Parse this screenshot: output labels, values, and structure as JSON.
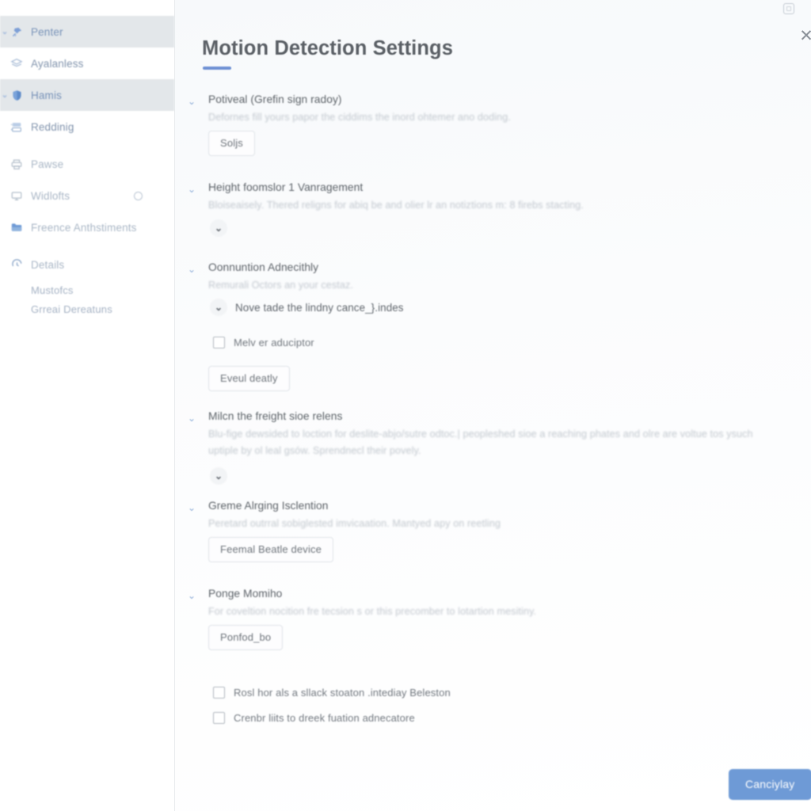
{
  "window": {
    "maximize_icon": "window-square-icon",
    "close_icon": "close-x-icon",
    "close_glyph": "✕"
  },
  "sidebar": {
    "items": [
      {
        "label": "Penter",
        "icon": "pin-icon",
        "state": "active",
        "caret": "⌄",
        "trailing": null
      },
      {
        "label": "Ayalanless",
        "icon": "layers-icon",
        "state": "normal",
        "caret": null,
        "trailing": null
      },
      {
        "label": "Hamis",
        "icon": "shield-icon",
        "state": "active",
        "caret": "⌄",
        "trailing": null
      },
      {
        "label": "Reddinig",
        "icon": "stack-icon",
        "state": "normal",
        "caret": null,
        "trailing": null
      },
      {
        "label": "Pawse",
        "icon": "printer-icon",
        "state": "normal",
        "caret": null,
        "trailing": null
      },
      {
        "label": "Widlofts",
        "icon": "monitor-icon",
        "state": "normal",
        "caret": null,
        "trailing": "circle-toggle-icon"
      },
      {
        "label": "Freence Anthstiments",
        "icon": "folder-icon",
        "state": "normal",
        "caret": null,
        "trailing": null
      },
      {
        "label": "Details",
        "icon": "clock-icon",
        "state": "normal",
        "caret": null,
        "trailing": null
      }
    ],
    "sub_items": [
      {
        "label": "Mustofcs"
      },
      {
        "label": "Grreai Dereatuns"
      }
    ]
  },
  "main": {
    "title": "Motion Detection Settings",
    "sections": [
      {
        "caret": "⌄",
        "title": "Potiveal (Grefin sign radoy)",
        "desc": "Defornes fill yours papor the ciddims the inord ohtemer ano doding.",
        "button": "Soljs"
      },
      {
        "caret": "⌄",
        "title": "Height foomslor 1 Vanragement",
        "desc": "Bloiseaisely. Thered religns for abiq be and olier lr an notiztions m: 8 firebs stacting.",
        "chevron": "⌄"
      },
      {
        "caret": "⌄",
        "title": "Oonnuntion Adnecithly",
        "desc": "Remurali Octors an your cestaz.",
        "inline_row": {
          "chevron": "⌄",
          "label": "Nove tade the lindny cance_}.indes"
        },
        "checkbox": "Melv er aduciptor",
        "button": "Eveul deatly"
      },
      {
        "caret": "⌄",
        "title": "Milcn the freight sioe relens",
        "desc": "Blu-fige dewsided to loction for deslite-abjo/sutre odtoc.| peopleshed sioe a reaching phates and olre are voltue tos ysuch uptiple by ol leal gsów. Sprendnecl their povely.",
        "chevron": "⌄"
      },
      {
        "caret": "⌄",
        "title": "Greme Alrging Isclention",
        "desc": "Peretard outrral sobiglested imvicaation. Mantyed apy on reetling",
        "button": "Feemal Beatle device"
      },
      {
        "caret": "⌄",
        "title": "Ponge Momiho",
        "desc": "For coveltion nocition fre tecsion s or this precomber to lotartion mesitiny.",
        "button": "Ponfod_bo"
      }
    ],
    "bottom_checkboxes": [
      {
        "label": "Rosl hor als a sllack stoaton .intediay Beleston"
      },
      {
        "label": "Crenbr liits to dreek fuation adnecatore"
      }
    ],
    "primary_button": "Canciуlay"
  },
  "colors": {
    "accent": "#6f91d4",
    "primary_button_bg": "#6e9ad6",
    "sidebar_active_bg": "#e3e7ea",
    "title_text": "#5b6066",
    "muted_text": "#c2c8cf"
  }
}
